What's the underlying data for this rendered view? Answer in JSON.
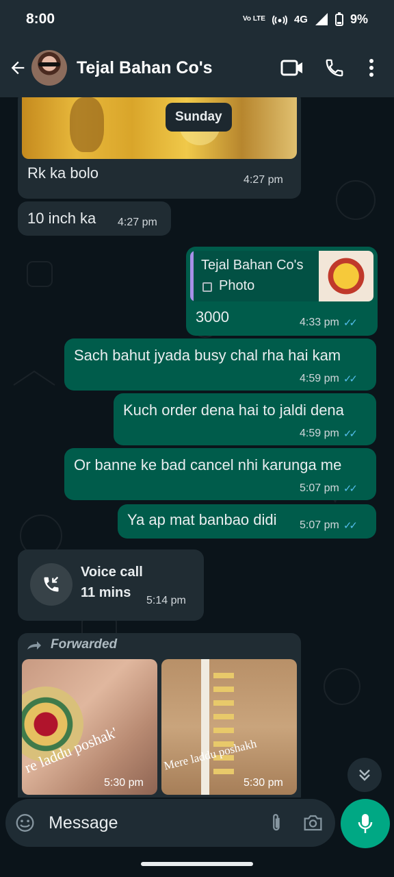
{
  "status": {
    "time": "8:00",
    "network": "4G",
    "battery": "9%",
    "lte": "Vo LTE"
  },
  "header": {
    "contact_name": "Tejal Bahan Co's"
  },
  "chat": {
    "day_chip": "Sunday",
    "messages": [
      {
        "text": "Rk ka bolo",
        "time": "4:27 pm"
      },
      {
        "text": "10 inch ka",
        "time": "4:27 pm"
      },
      {
        "reply_name": "Tejal Bahan Co's",
        "reply_type": "Photo",
        "text": "3000",
        "time": "4:33 pm"
      },
      {
        "text": "Sach bahut jyada busy chal rha hai kam",
        "time": "4:59 pm"
      },
      {
        "text": "Kuch order dena hai to jaldi dena",
        "time": "4:59 pm"
      },
      {
        "text": "Or banne ke bad cancel nhi karunga me",
        "time": "5:07 pm"
      },
      {
        "text": "Ya ap mat banbao didi",
        "time": "5:07 pm"
      }
    ],
    "voice_call": {
      "label": "Voice call",
      "duration": "11 mins",
      "time": "5:14 pm"
    },
    "forwarded": {
      "label": "Forwarded",
      "photos": [
        {
          "watermark": "re laddu poshak'",
          "time": "5:30 pm"
        },
        {
          "watermark": "Mere laddu poshakh",
          "time": "5:30 pm"
        }
      ]
    }
  },
  "composer": {
    "placeholder": "Message"
  },
  "colors": {
    "incoming": "#202c33",
    "outgoing": "#005c4b",
    "accent": "#00a884",
    "read_ticks": "#53bdeb"
  }
}
